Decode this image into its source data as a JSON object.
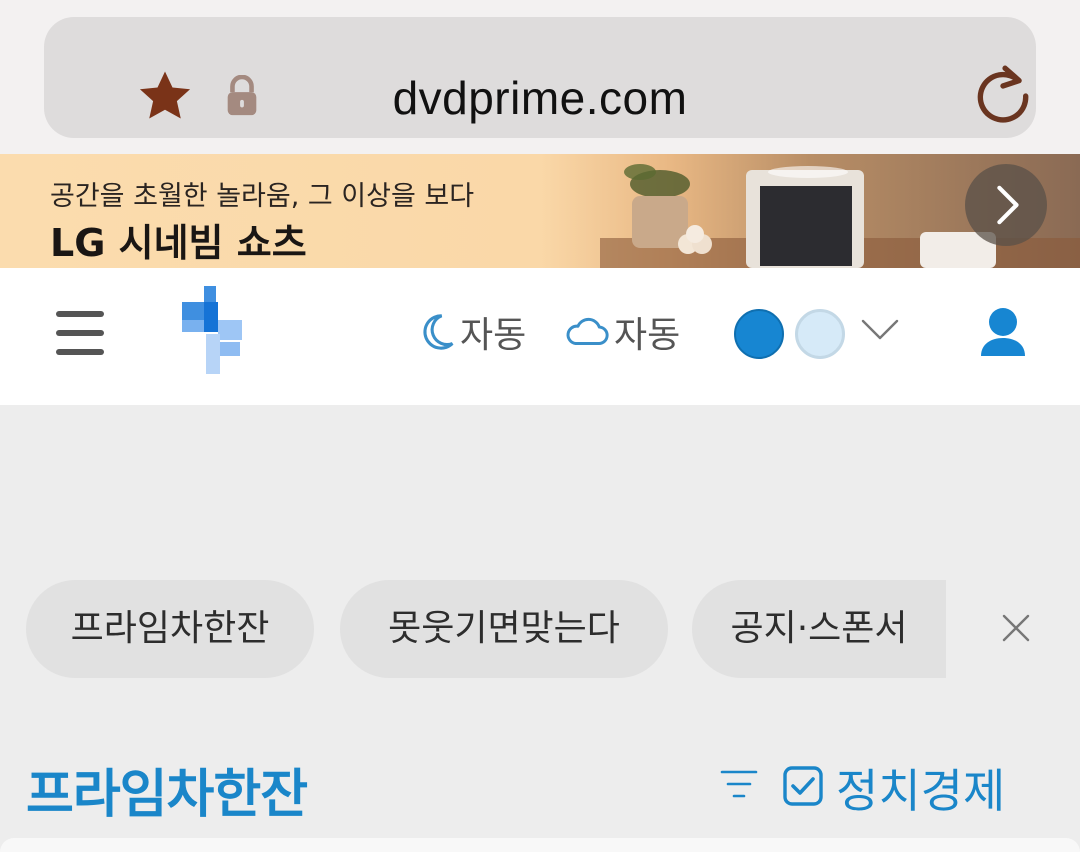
{
  "browser": {
    "url": "dvdprime.com",
    "colors": {
      "bar": "#dedcdc",
      "star": "#7a3318",
      "lock": "#a48a80",
      "reload": "#6a3520"
    }
  },
  "ad": {
    "subtitle": "공간을 초월한 놀라움, 그 이상을 보다",
    "headline": "LG 시네빔 쇼츠",
    "next_icon": "chevron-right-icon"
  },
  "header": {
    "menu_icon": "hamburger-icon",
    "logo": "dp-logo",
    "dark_mode_label": "자동",
    "weather_mode_label": "자동",
    "theme_colors": [
      "#1786d2",
      "#d6eaf8"
    ],
    "user_icon": "user-icon"
  },
  "tabs": {
    "items": [
      {
        "label": "프라임차한잔"
      },
      {
        "label": "못웃기면맞는다"
      },
      {
        "label": "공지·스폰서"
      }
    ]
  },
  "section": {
    "title": "프라임차한잔",
    "filter_label": "정치경제",
    "accent": "#1a86c9"
  }
}
